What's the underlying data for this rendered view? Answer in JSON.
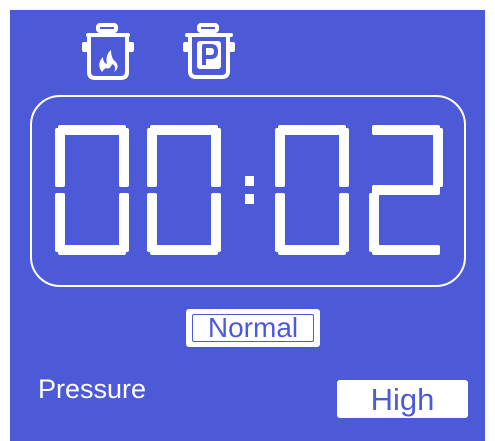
{
  "display": {
    "time": "00:02",
    "mode": "Normal",
    "pressure_label": "Pressure",
    "pressure_level": "High"
  },
  "icons": {
    "cook": "pot-with-flame-icon",
    "pressure": "pot-with-p-icon"
  },
  "colors": {
    "background": "#4c5ad8",
    "foreground": "#ffffff"
  }
}
